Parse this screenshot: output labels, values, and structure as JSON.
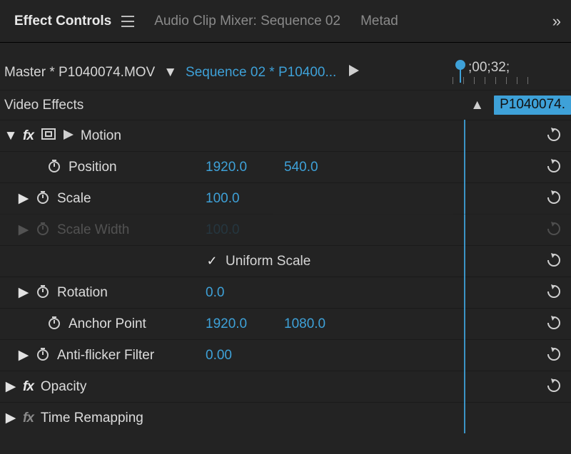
{
  "tabs": {
    "effect_controls": "Effect Controls",
    "audio_mixer": "Audio Clip Mixer: Sequence 02",
    "metadata": "Metad"
  },
  "source": {
    "master": "Master * P1040074.MOV",
    "sequence": "Sequence 02 * P10400...",
    "timecode": ";00;32;"
  },
  "section": {
    "title": "Video Effects",
    "clip_name": "P1040074."
  },
  "motion": {
    "label": "Motion",
    "position": {
      "label": "Position",
      "x": "1920.0",
      "y": "540.0"
    },
    "scale": {
      "label": "Scale",
      "value": "100.0"
    },
    "scale_width": {
      "label": "Scale Width",
      "value": "100.0"
    },
    "uniform_scale": {
      "label": "Uniform Scale",
      "checked": true
    },
    "rotation": {
      "label": "Rotation",
      "value": "0.0"
    },
    "anchor": {
      "label": "Anchor Point",
      "x": "1920.0",
      "y": "1080.0"
    },
    "antiflicker": {
      "label": "Anti-flicker Filter",
      "value": "0.00"
    }
  },
  "opacity": {
    "label": "Opacity"
  },
  "time_remapping": {
    "label": "Time Remapping"
  }
}
